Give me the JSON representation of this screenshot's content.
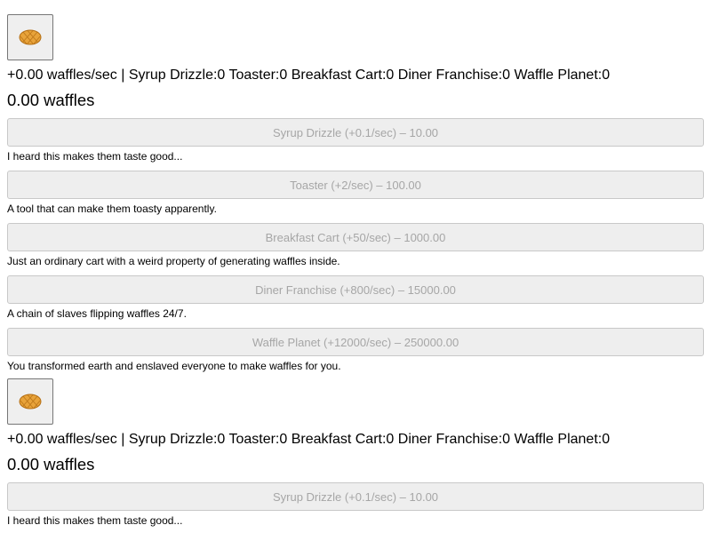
{
  "game": {
    "stats_line": "+0.00 waffles/sec | Syrup Drizzle:0 Toaster:0 Breakfast Cart:0 Diner Franchise:0 Waffle Planet:0",
    "waffle_count": "0.00 waffles",
    "waffle_icon": "waffle-icon",
    "upgrades": [
      {
        "label": "Syrup Drizzle (+0.1/sec) – 10.00",
        "description": "I heard this makes them taste good...",
        "disabled": true
      },
      {
        "label": "Toaster (+2/sec) – 100.00",
        "description": "A tool that can make them toasty apparently.",
        "disabled": true
      },
      {
        "label": "Breakfast Cart (+50/sec) – 1000.00",
        "description": "Just an ordinary cart with a weird property of generating waffles inside.",
        "disabled": true
      },
      {
        "label": "Diner Franchise (+800/sec) – 15000.00",
        "description": "A chain of slaves flipping waffles 24/7.",
        "disabled": true
      },
      {
        "label": "Waffle Planet (+12000/sec) – 250000.00",
        "description": "You transformed earth and enslaved everyone to make waffles for you.",
        "disabled": true
      }
    ]
  },
  "colors": {
    "upgrade_text": "#a6a6a6",
    "upgrade_bg": "#eeeeee",
    "waffle": "#e8a33a"
  }
}
